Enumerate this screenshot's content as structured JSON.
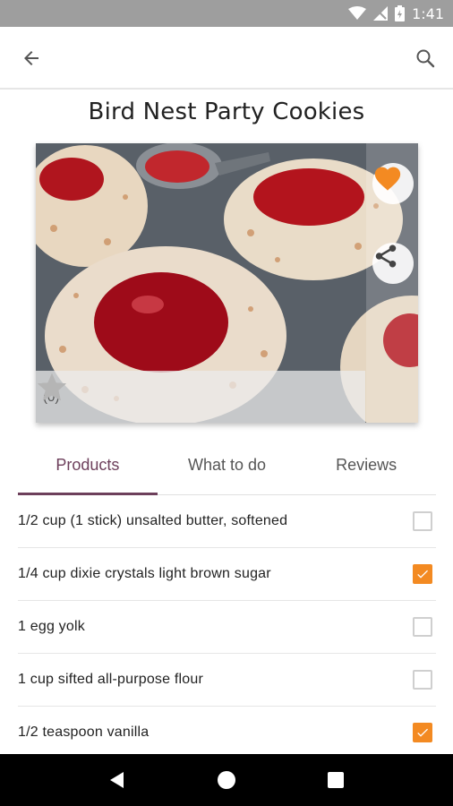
{
  "status_bar": {
    "time": "1:41",
    "icons": [
      "wifi-icon",
      "signal-icon",
      "battery-icon"
    ]
  },
  "app_bar": {
    "back_icon": "arrow-left-icon",
    "search_icon": "search-icon"
  },
  "recipe": {
    "title": "Bird Nest Party Cookies",
    "rating": {
      "stars": 0,
      "max_stars": 5,
      "count_label": "(0)"
    },
    "favorite": {
      "active": true,
      "icon": "heart-icon"
    },
    "share_icon": "share-icon"
  },
  "tabs": [
    {
      "label": "Products",
      "active": true
    },
    {
      "label": "What to do",
      "active": false
    },
    {
      "label": "Reviews",
      "active": false
    }
  ],
  "ingredients": [
    {
      "text": "1/2 cup (1 stick) unsalted butter, softened",
      "checked": false
    },
    {
      "text": "1/4 cup dixie crystals light brown sugar",
      "checked": true
    },
    {
      "text": "1 egg yolk",
      "checked": false
    },
    {
      "text": "1 cup sifted all-purpose flour",
      "checked": false
    },
    {
      "text": "1/2 teaspoon vanilla",
      "checked": true
    }
  ],
  "navigation": {
    "buttons": [
      "back-triangle-icon",
      "home-circle-icon",
      "recents-square-icon"
    ]
  },
  "colors": {
    "accent": "#f38a22",
    "tab_active": "#6d3f5b",
    "status_bar": "#9e9e9e"
  }
}
